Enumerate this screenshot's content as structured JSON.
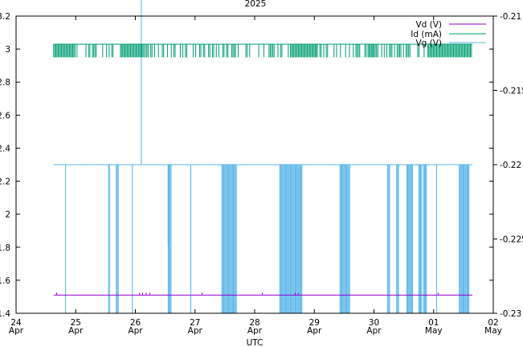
{
  "chart_data": {
    "type": "line",
    "title": "2025",
    "xlabel": "UTC",
    "x_ticks": [
      {
        "day": "24",
        "month": "Apr",
        "t": 24
      },
      {
        "day": "25",
        "month": "Apr",
        "t": 25
      },
      {
        "day": "26",
        "month": "Apr",
        "t": 26
      },
      {
        "day": "27",
        "month": "Apr",
        "t": 27
      },
      {
        "day": "28",
        "month": "Apr",
        "t": 28
      },
      {
        "day": "29",
        "month": "Apr",
        "t": 29
      },
      {
        "day": "30",
        "month": "Apr",
        "t": 30
      },
      {
        "day": "01",
        "month": "May",
        "t": 31
      },
      {
        "day": "02",
        "month": "May",
        "t": 32
      }
    ],
    "xlim": [
      24,
      32
    ],
    "y_left": {
      "lim": [
        1.4,
        3.2
      ],
      "ticks": [
        "1.4",
        "1.6",
        "1.8",
        "2",
        "2.2",
        "2.4",
        "2.6",
        "2.8",
        "3",
        "3.2"
      ],
      "tick_values": [
        1.4,
        1.6,
        1.8,
        2.0,
        2.2,
        2.4,
        2.6,
        2.8,
        3.0,
        3.2
      ]
    },
    "y_right": {
      "lim": [
        -0.23,
        -0.21
      ],
      "ticks": [
        "-0.23",
        "-0.225",
        "-0.22",
        "-0.215",
        "-0.21"
      ],
      "tick_values": [
        -0.23,
        -0.225,
        -0.22,
        -0.215,
        -0.21
      ]
    },
    "grid": false,
    "legend_position": "top-right",
    "series": [
      {
        "name": "Vd (V)",
        "axis": "left",
        "color": "#9400d3",
        "x_range": [
          24.63,
          31.65
        ],
        "baseline": 1.51,
        "spike_to": 1.52,
        "spikes_x": [
          24.68,
          26.07,
          26.12,
          26.18,
          26.24,
          27.12,
          28.13,
          28.68,
          28.73,
          31.08
        ]
      },
      {
        "name": "Id (mA)",
        "axis": "left",
        "color": "#009e73",
        "x_range": [
          24.63,
          31.65
        ],
        "high": 3.03,
        "low": 2.95,
        "note_sparse_ranges": [
          [
            25.0,
            25.75
          ],
          [
            26.15,
            28.6
          ],
          [
            29.05,
            29.9
          ],
          [
            30.0,
            30.9
          ]
        ],
        "note_dense_ranges": [
          [
            24.63,
            25.0
          ],
          [
            25.75,
            26.15
          ],
          [
            28.6,
            29.05
          ],
          [
            29.9,
            30.0
          ],
          [
            30.9,
            31.65
          ]
        ]
      },
      {
        "name": "Vg (V)",
        "axis": "right",
        "color": "#56b4e9",
        "x_range": [
          24.63,
          31.65
        ],
        "high": -0.22,
        "low": -0.23,
        "spike_up": {
          "x": 26.1,
          "to": -0.2085
        },
        "partial_drop": {
          "x": 26.55,
          "to": -0.2254
        },
        "single_drops": [
          24.83,
          25.95,
          26.93,
          31.05
        ],
        "dense_drops": [
          [
            25.55,
            25.58
          ],
          [
            25.68,
            25.72
          ],
          [
            26.55,
            26.6
          ],
          [
            27.45,
            27.7
          ],
          [
            28.42,
            28.8
          ],
          [
            29.43,
            29.6
          ],
          [
            30.23,
            30.27
          ],
          [
            30.38,
            30.42
          ],
          [
            30.55,
            30.65
          ],
          [
            30.75,
            30.8
          ],
          [
            30.83,
            30.88
          ],
          [
            31.43,
            31.6
          ]
        ]
      }
    ]
  }
}
